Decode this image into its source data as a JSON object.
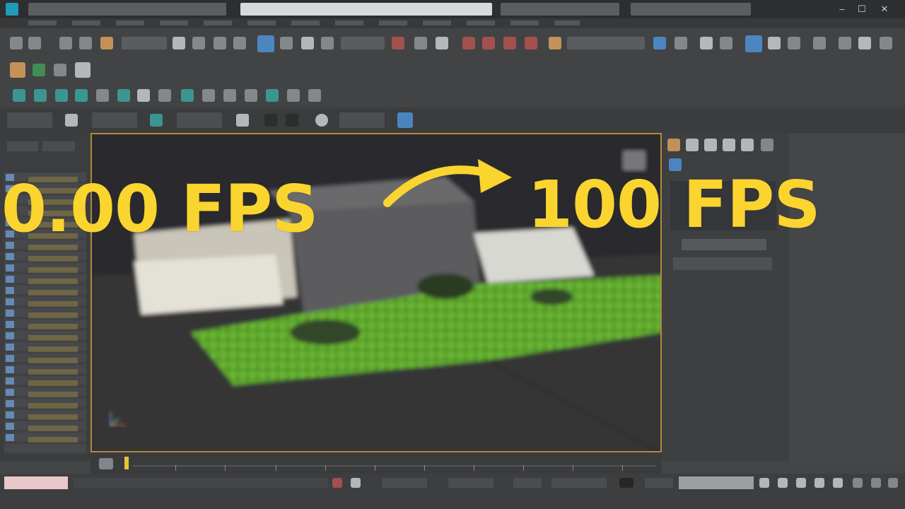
{
  "overlay": {
    "fps_before": "0.00 FPS",
    "fps_after": "100 FPS",
    "text_color": "#FAD42F",
    "arrow_color": "#FAD42F"
  },
  "window": {
    "title_bar_color": "#2D2E30",
    "viewport_border_color": "#B08A3A",
    "controls": [
      "minimize-icon",
      "maximize-icon",
      "close-icon"
    ],
    "control_glyphs": [
      "–",
      "☐",
      "✕"
    ]
  },
  "scene": {
    "grass_color": "#5FA82E",
    "block_color": "#5C5C5E",
    "floor_color": "#2C2C2D"
  },
  "icons": {
    "app": "3ds-max-logo-icon",
    "view_cube": "view-cube-icon",
    "axis_gizmo": "axis-gizmo-icon",
    "time_slider": "time-slider-icon"
  }
}
